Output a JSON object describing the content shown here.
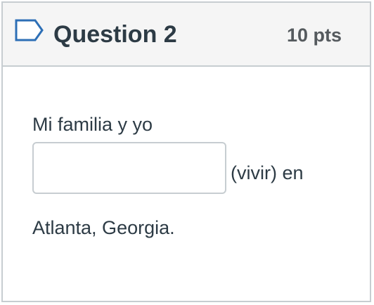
{
  "question": {
    "flag_icon": "bookmark-flag-icon",
    "title": "Question 2",
    "points": "10 pts"
  },
  "body": {
    "text_before": "Mi familia y yo",
    "input_value": "",
    "text_after_input": "(vivir) en",
    "text_end": "Atlanta, Georgia."
  },
  "colors": {
    "text": "#2d3b45",
    "border": "#c7cdd1",
    "header_bg": "#f5f5f5",
    "points_text": "#555a5e"
  }
}
